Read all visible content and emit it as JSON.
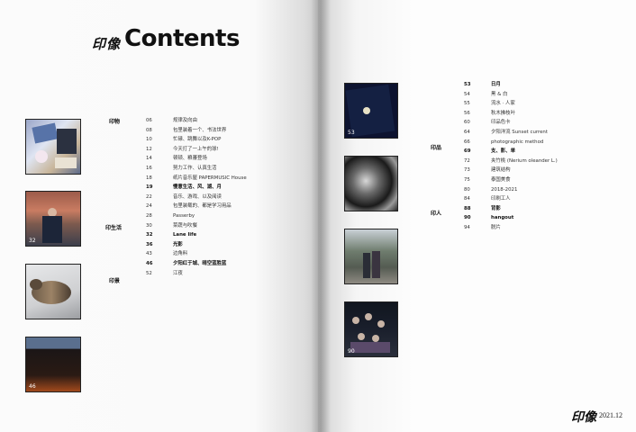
{
  "header": {
    "brand": "印像",
    "title": "Contents"
  },
  "left_sections": [
    {
      "label": "印物"
    },
    {
      "label": "印生活"
    },
    {
      "label": "印景"
    }
  ],
  "left_entries": [
    {
      "page": "06",
      "title": "规律及向由",
      "bold": false
    },
    {
      "page": "08",
      "title": "包里装着一个、书法世界",
      "bold": false
    },
    {
      "page": "10",
      "title": "忙碌、跳舞以及K-POP",
      "bold": false
    },
    {
      "page": "12",
      "title": "今天打了一上午的球!",
      "bold": false
    },
    {
      "page": "14",
      "title": "顿顿、粮蕃登场",
      "bold": false
    },
    {
      "page": "16",
      "title": "努力工作、认真生活",
      "bold": false
    },
    {
      "page": "18",
      "title": "纸片音乐屋 PAPERMUSIC House",
      "bold": false
    },
    {
      "page": "19",
      "title": "慢意生活、风、湖、月",
      "bold": true
    },
    {
      "page": "22",
      "title": "音乐、游戏、以及阅读",
      "bold": false
    },
    {
      "page": "24",
      "title": "包里装载的、都是学习用品",
      "bold": false
    },
    {
      "page": "28",
      "title": "Passerby",
      "bold": false
    },
    {
      "page": "30",
      "title": "菜蔬与吹餐",
      "bold": false
    },
    {
      "page": "32",
      "title": "Lane life",
      "bold": true
    },
    {
      "page": "36",
      "title": "光影",
      "bold": true
    },
    {
      "page": "43",
      "title": "边角料",
      "bold": false
    },
    {
      "page": "46",
      "title": "夕阳红于城、晴空蓝胜蓝",
      "bold": true
    },
    {
      "page": "52",
      "title": "江夜",
      "bold": false
    }
  ],
  "left_thumbs": [
    {
      "num": "",
      "name": "thumb-desk-objects"
    },
    {
      "num": "32",
      "name": "thumb-passerby"
    },
    {
      "num": "",
      "name": "thumb-cat"
    },
    {
      "num": "46",
      "name": "thumb-sunset"
    }
  ],
  "right_sections": [
    {
      "label": "印品"
    },
    {
      "label": "印人"
    }
  ],
  "right_entries": [
    {
      "page": "53",
      "title": "日月",
      "bold": true
    },
    {
      "page": "54",
      "title": "黑 & 白",
      "bold": false
    },
    {
      "page": "55",
      "title": "流水 · 人家",
      "bold": false
    },
    {
      "page": "56",
      "title": "秋木拂枝叶",
      "bold": false
    },
    {
      "page": "60",
      "title": "印品色卡",
      "bold": false
    },
    {
      "page": "64",
      "title": "夕阳洋流 Sunset current",
      "bold": false
    },
    {
      "page": "66",
      "title": "photographic method",
      "bold": false
    },
    {
      "page": "69",
      "title": "支、影、单",
      "bold": true
    },
    {
      "page": "72",
      "title": "夹竹桃 (Nerium oleander L.)",
      "bold": false
    },
    {
      "page": "73",
      "title": "建筑结构",
      "bold": false
    },
    {
      "page": "75",
      "title": "泰国美食",
      "bold": false
    },
    {
      "page": "80",
      "title": "2018-2021",
      "bold": false
    },
    {
      "page": "84",
      "title": "印刷工人",
      "bold": false
    },
    {
      "page": "88",
      "title": "背影",
      "bold": true
    },
    {
      "page": "90",
      "title": "hangout",
      "bold": true
    },
    {
      "page": "94",
      "title": "脱片",
      "bold": false
    }
  ],
  "right_thumbs": [
    {
      "num": "53",
      "name": "thumb-moon"
    },
    {
      "num": "",
      "name": "thumb-black-white-flowers"
    },
    {
      "num": "",
      "name": "thumb-street-couple"
    },
    {
      "num": "90",
      "name": "thumb-group-hangout"
    }
  ],
  "footer": {
    "brand": "印像",
    "date": "2021.12"
  }
}
